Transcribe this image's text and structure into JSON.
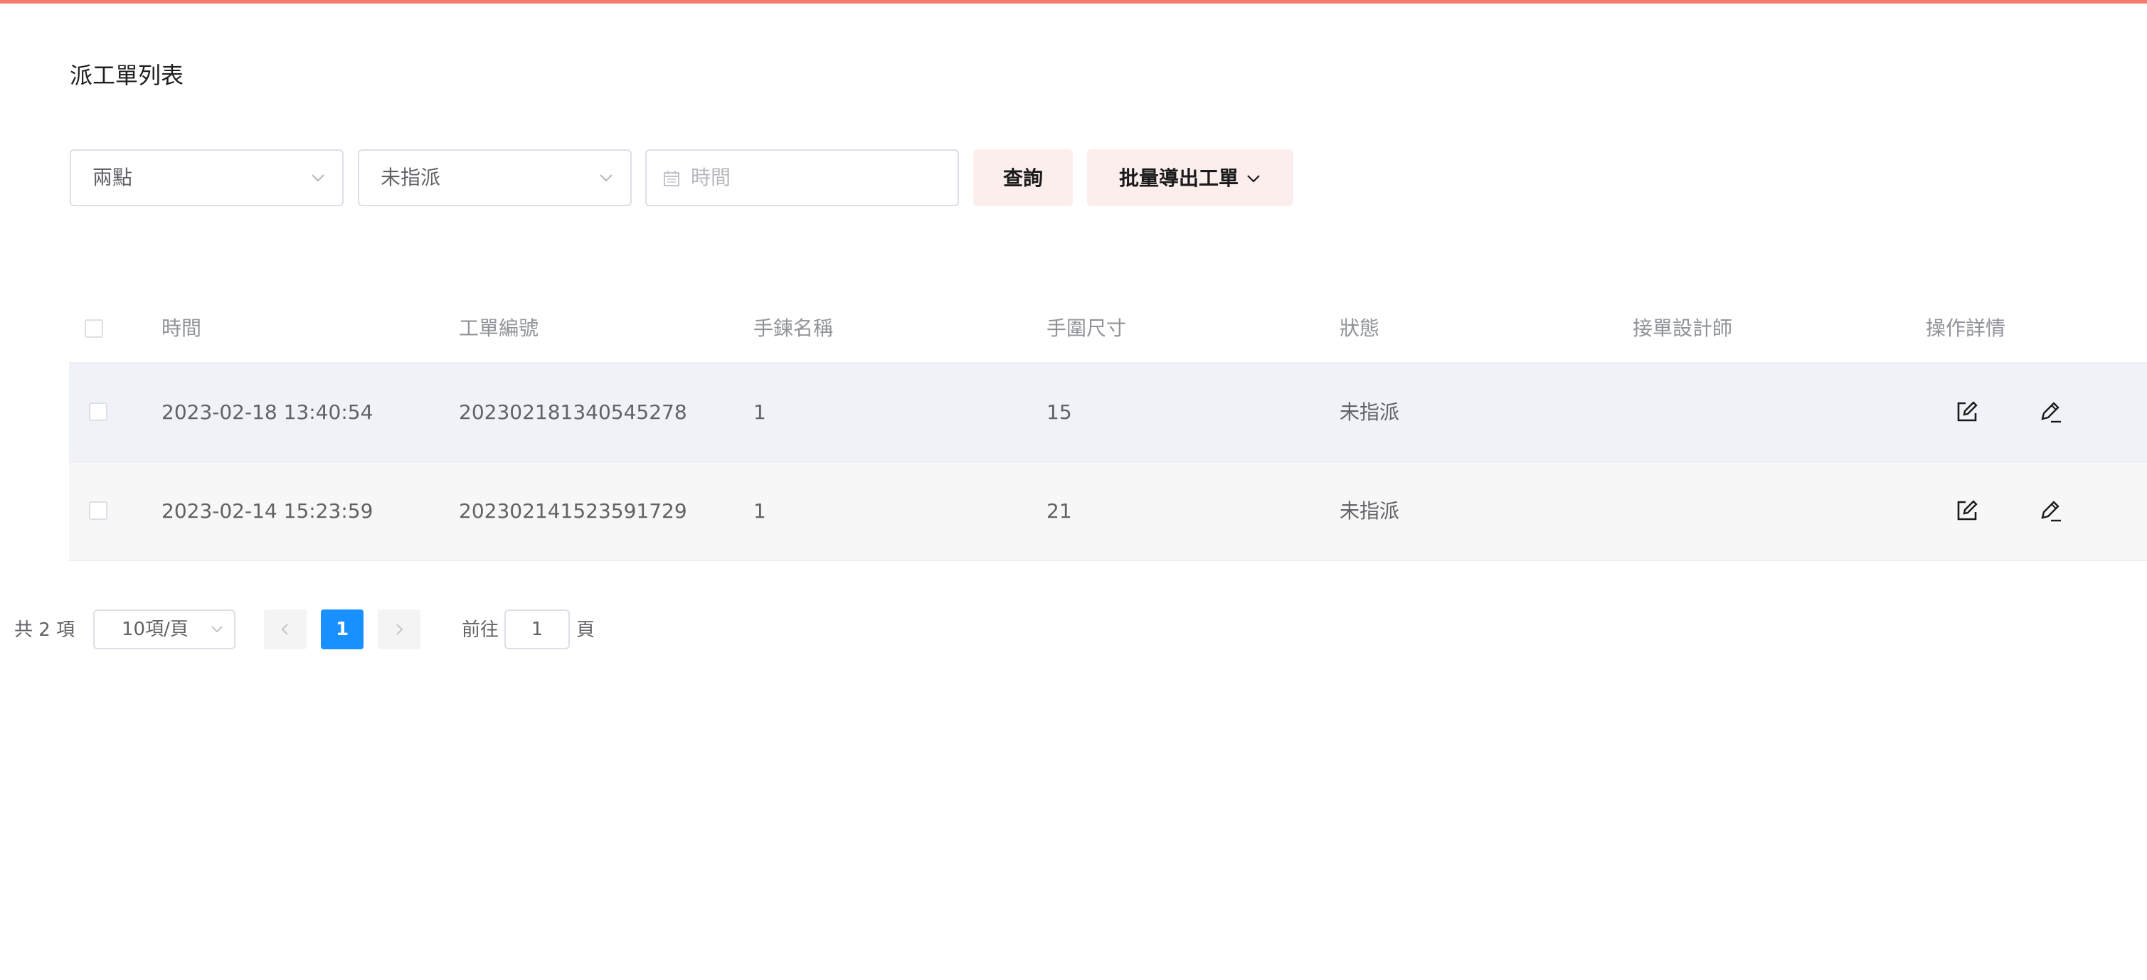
{
  "page": {
    "title": "派工單列表",
    "accent_color": "#f47b6e"
  },
  "filters": {
    "shop_select": {
      "value": "兩點",
      "icon": "chevron-down-icon"
    },
    "status_select": {
      "value": "未指派",
      "icon": "chevron-down-icon"
    },
    "date_input": {
      "placeholder": "時間",
      "icon": "calendar-icon"
    },
    "query_button": "查詢",
    "export_button": "批量導出工單"
  },
  "table": {
    "columns": [
      "時間",
      "工單編號",
      "手鍊名稱",
      "手圍尺寸",
      "狀態",
      "接單設計師",
      "操作詳情"
    ],
    "rows": [
      {
        "time": "2023-02-18 13:40:54",
        "order_no": "202302181340545278",
        "name": "1",
        "size": "15",
        "status": "未指派",
        "designer": ""
      },
      {
        "time": "2023-02-14 15:23:59",
        "order_no": "202302141523591729",
        "name": "1",
        "size": "21",
        "status": "未指派",
        "designer": ""
      }
    ],
    "row_actions": [
      "edit-icon",
      "pen-icon"
    ]
  },
  "pagination": {
    "total_label": "共 2 項",
    "page_size": "10項/頁",
    "current_page": "1",
    "goto_label": "前往",
    "goto_value": "1",
    "goto_suffix": "頁",
    "active_color": "#1890ff"
  }
}
